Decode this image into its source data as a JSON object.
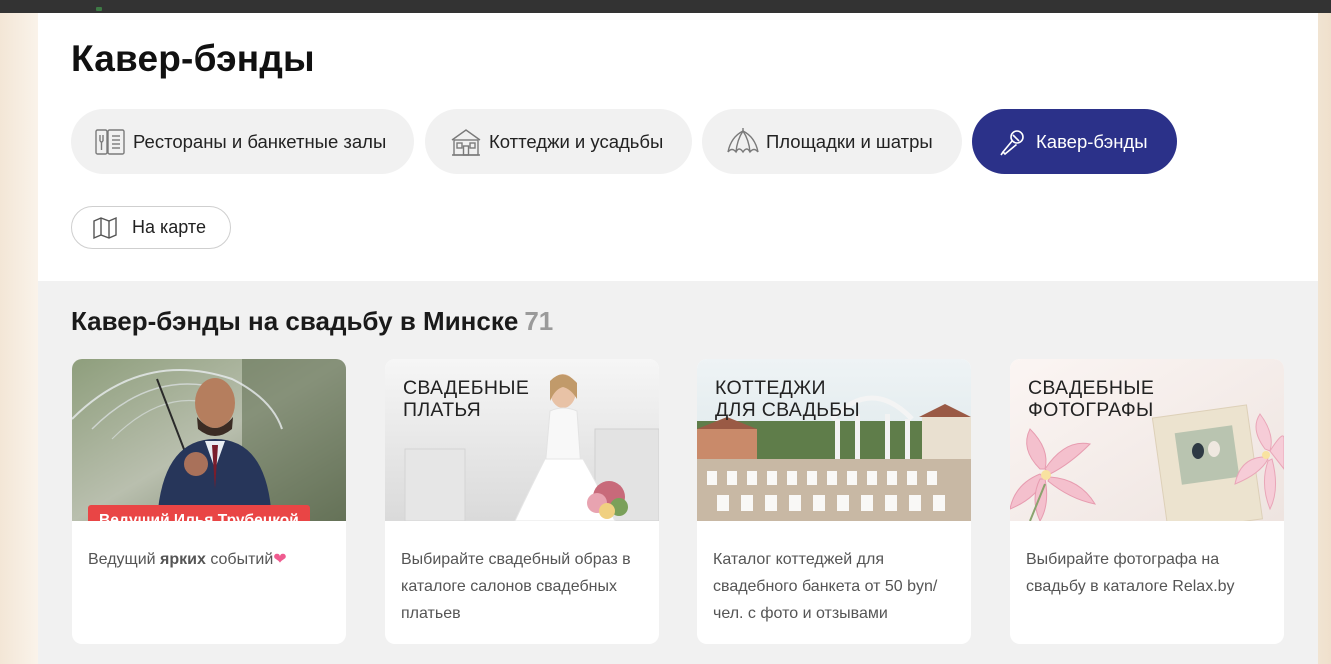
{
  "page": {
    "title": "Кавер-бэнды"
  },
  "categories": [
    {
      "label": "Рестораны и банкетные залы",
      "icon": "menu-icon",
      "active": false
    },
    {
      "label": "Коттеджи и усадьбы",
      "icon": "house-icon",
      "active": false
    },
    {
      "label": "Площадки и шатры",
      "icon": "tent-icon",
      "active": false
    },
    {
      "label": "Кавер-бэнды",
      "icon": "microphone-icon",
      "active": true
    }
  ],
  "map_button": {
    "label": "На карте",
    "icon": "map-icon"
  },
  "section": {
    "title": "Кавер-бэнды на свадьбу в Минске",
    "count": "71"
  },
  "cards": [
    {
      "badge": "Ведущий Илья Трубецкой",
      "desc_before": "Ведущий ",
      "desc_bold": "ярких",
      "desc_after": " событий",
      "desc_emoji": "❤"
    },
    {
      "banner_line1": "СВАДЕБНЫЕ",
      "banner_line2": "ПЛАТЬЯ",
      "desc": "Выбирайте свадебный образ в каталоге салонов свадебных платьев"
    },
    {
      "banner_line1": "КОТТЕДЖИ",
      "banner_line2": "ДЛЯ СВАДЬБЫ",
      "desc": "Каталог коттеджей для свадебного банкета от 50 byn/чел. с фото и отзывами"
    },
    {
      "banner_line1": "СВАДЕБНЫЕ",
      "banner_line2": "ФОТОГРАФЫ",
      "desc": "Выбирайте фотографа на свадьбу в каталоге Relax.by"
    }
  ],
  "colors": {
    "accent": "#2b3189",
    "badge": "#e94545",
    "chip_bg": "#f1f1f1",
    "section_bg": "#f1f1f1"
  }
}
